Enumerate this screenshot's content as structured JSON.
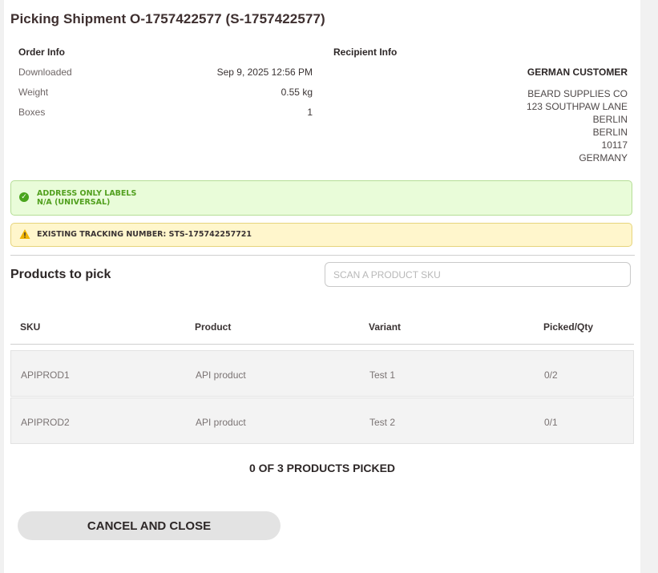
{
  "title": "Picking Shipment O-1757422577 (S-1757422577)",
  "order_info": {
    "heading": "Order Info",
    "rows": [
      {
        "label": "Downloaded",
        "value": "Sep 9, 2025 12:56 PM"
      },
      {
        "label": "Weight",
        "value": "0.55 kg"
      },
      {
        "label": "Boxes",
        "value": "1"
      }
    ]
  },
  "recipient_info": {
    "heading": "Recipient Info",
    "name": "GERMAN CUSTOMER",
    "address_lines": [
      "BEARD SUPPLIES CO",
      "123 SOUTHPAW LANE",
      "BERLIN",
      "BERLIN",
      "10117",
      "GERMANY"
    ]
  },
  "alerts": {
    "success": {
      "line1": "ADDRESS ONLY LABELS",
      "line2": "N/A (UNIVERSAL)",
      "icon": "check-circle-icon",
      "color": "#52a01f"
    },
    "warning": {
      "text": "EXISTING TRACKING NUMBER: STS-175742257721",
      "icon": "warning-triangle-icon",
      "color": "#f0b400"
    }
  },
  "products": {
    "heading": "Products to pick",
    "scan_placeholder": "SCAN A PRODUCT SKU",
    "scan_value": "",
    "columns": [
      "SKU",
      "Product",
      "Variant",
      "Picked/Qty"
    ],
    "rows": [
      {
        "sku": "APIPROD1",
        "product": "API product",
        "variant": "Test 1",
        "picked_qty": "0/2"
      },
      {
        "sku": "APIPROD2",
        "product": "API product",
        "variant": "Test 2",
        "picked_qty": "0/1"
      }
    ]
  },
  "summary": "0 OF 3 PRODUCTS PICKED",
  "cancel_label": "CANCEL AND CLOSE"
}
